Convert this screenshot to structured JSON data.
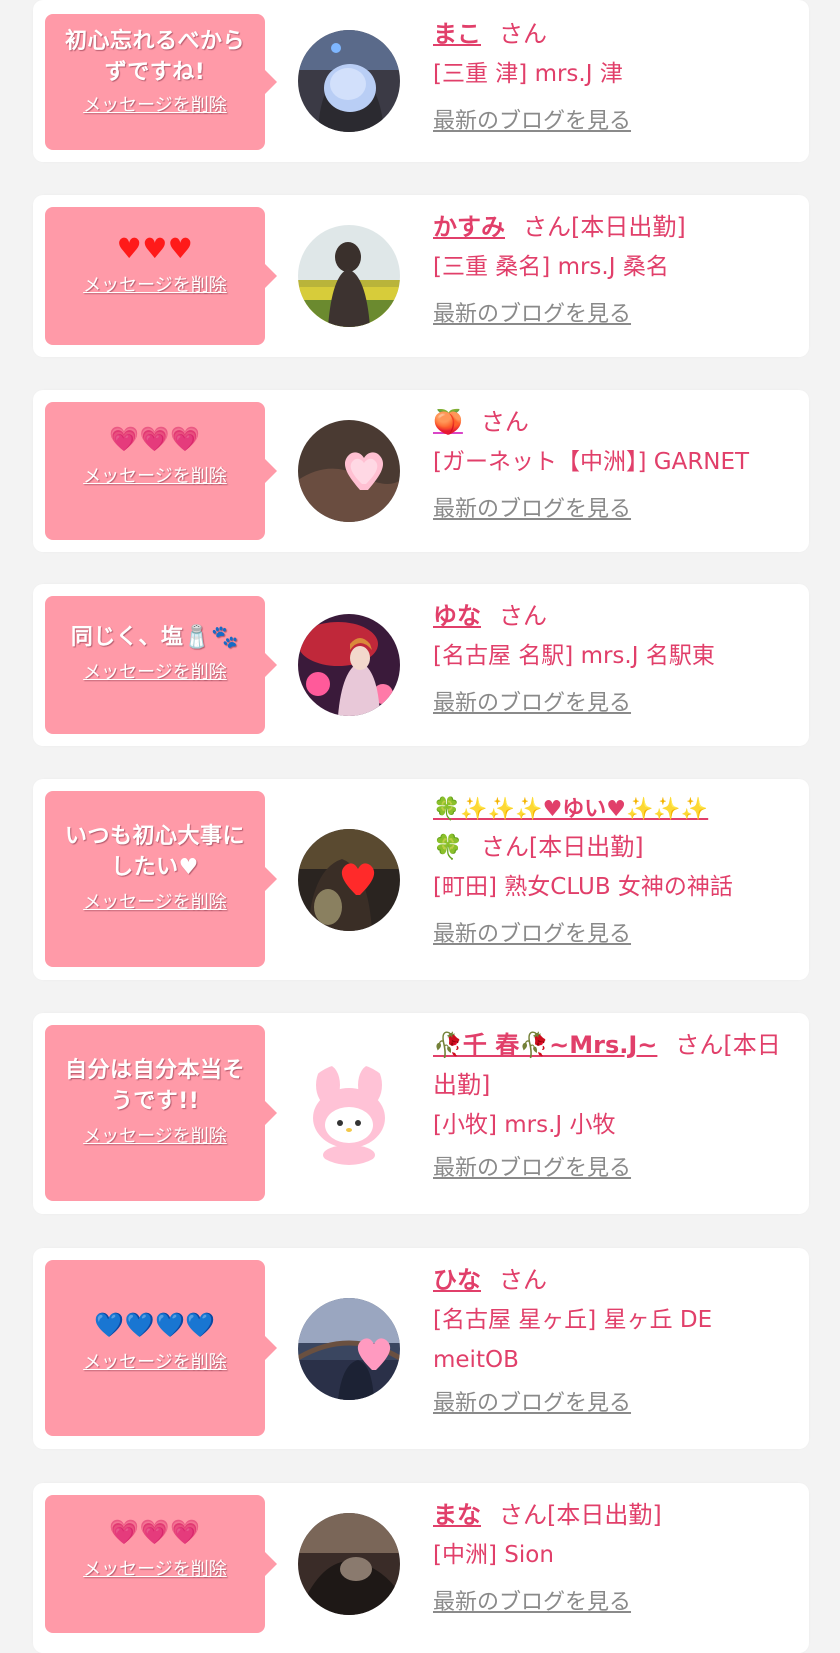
{
  "common": {
    "delete_label": "メッセージを削除",
    "blog_label": "最新のブログを見る",
    "san_label": "さん"
  },
  "colors": {
    "page_bg": "#f3f3f3",
    "card_bg": "#ffffff",
    "bubble_bg": "#ff9aa8",
    "accent_text": "#e13f6a",
    "blog_link": "#8a8a8a"
  },
  "messages": [
    {
      "message_lines": [
        "初心忘れるべから",
        "ずですね!"
      ],
      "name": "まこ",
      "suffix": "さん",
      "shop": "[三重 津] mrs.J 津",
      "avatar_icon": "girl-photo-blue-blur"
    },
    {
      "message_lines": [
        "♥♥♥"
      ],
      "name": "かすみ",
      "suffix": "さん[本日出勤]",
      "shop": "[三重 桑名] mrs.J 桑名",
      "avatar_icon": "girl-photo-flower-field"
    },
    {
      "message_lines": [
        "💗💗💗"
      ],
      "name": "🍑",
      "suffix": "さん",
      "shop": "[ガーネット【中洲】] GARNET",
      "avatar_icon": "girl-photo-pink-heart"
    },
    {
      "message_lines": [
        "同じく、塩🧂🐾"
      ],
      "name": "ゆな",
      "suffix": "さん",
      "shop": "[名古屋 名駅] mrs.J 名駅東",
      "avatar_icon": "girl-photo-kimono"
    },
    {
      "message_lines": [
        "いつも初心大事に",
        "したい♥"
      ],
      "name_line1": "🍀✨✨✨♥ゆい♥✨✨✨",
      "name_line2": "🍀",
      "suffix": "さん[本日出勤]",
      "shop": "[町田] 熟女CLUB 女神の神話",
      "avatar_icon": "girl-photo-red-heart"
    },
    {
      "message_lines": [
        "自分は自分本当そ",
        "うです!!"
      ],
      "name": "🥀千 春🥀~Mrs.J~",
      "suffix": "さん[本日",
      "suffix_line2": "出勤]",
      "shop": "[小牧] mrs.J 小牧",
      "avatar_icon": "plush-toy-pink-bunny"
    },
    {
      "message_lines": [
        "💙💙💙💙"
      ],
      "name": "ひな",
      "suffix": "さん",
      "shop": "[名古屋 星ヶ丘] 星ヶ丘 DE",
      "shop_line2": "meitOB",
      "avatar_icon": "girl-photo-bridge-heart"
    },
    {
      "message_lines": [
        "💗💗💗"
      ],
      "name": "まな",
      "suffix": "さん[本日出勤]",
      "shop": "[中洲] Sion",
      "avatar_icon": "girl-photo-dark"
    }
  ]
}
